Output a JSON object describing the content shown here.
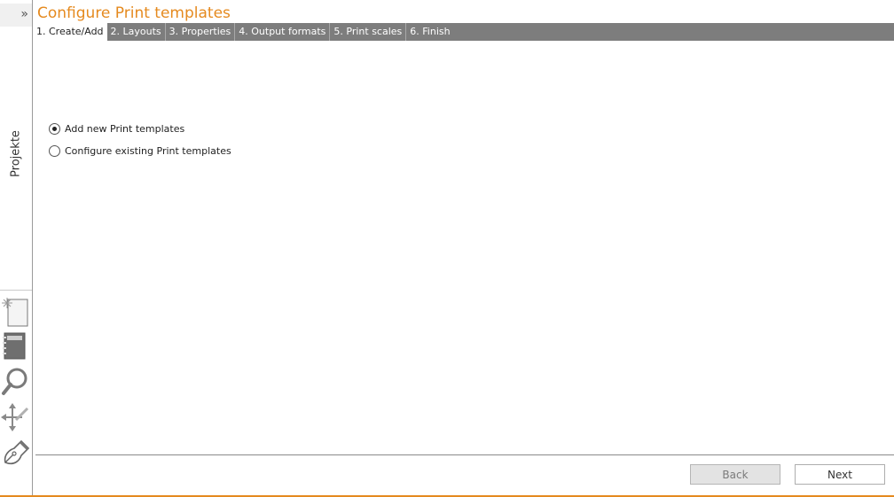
{
  "sidebar": {
    "collapse_glyph": "»",
    "vertical_tab_label": "Projekte",
    "tools": [
      {
        "icon": "new-document-icon"
      },
      {
        "icon": "notebook-icon"
      },
      {
        "icon": "magnifier-icon"
      },
      {
        "icon": "move-edit-icon"
      },
      {
        "icon": "pen-nib-icon"
      }
    ]
  },
  "header": {
    "title": "Configure Print templates"
  },
  "steps": [
    {
      "label": "1. Create/Add",
      "active": true
    },
    {
      "label": "2. Layouts",
      "active": false
    },
    {
      "label": "3. Properties",
      "active": false
    },
    {
      "label": "4. Output formats",
      "active": false
    },
    {
      "label": "5. Print scales",
      "active": false
    },
    {
      "label": "6. Finish",
      "active": false
    }
  ],
  "options": [
    {
      "label": "Add new Print templates",
      "selected": true
    },
    {
      "label": "Configure existing Print templates",
      "selected": false
    }
  ],
  "footer": {
    "back_label": "Back",
    "next_label": "Next",
    "back_enabled": false
  },
  "colors": {
    "accent": "#e58a1f",
    "tabbar": "#7d7d7d"
  }
}
